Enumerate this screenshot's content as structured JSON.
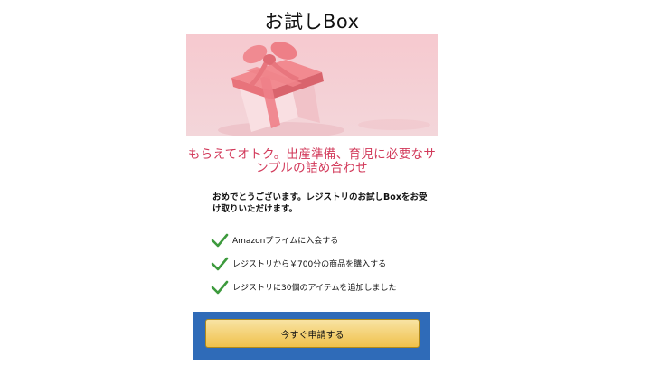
{
  "page": {
    "title": "お試しBox"
  },
  "hero": {
    "image": "pink-gift-box-with-ribbon"
  },
  "tagline": "もらえてオトク。出産準備、育児に必要なサンプルの詰め合わせ",
  "congrats": "おめでとうございます。レジストリのお試しBoxをお受け取りいただけます。",
  "requirements": [
    {
      "icon": "checkmark-icon",
      "label": "Amazonプライムに入会する"
    },
    {
      "icon": "checkmark-icon",
      "label": "レジストリから￥700分の商品を購入する"
    },
    {
      "icon": "checkmark-icon",
      "label": "レジストリに30個のアイテムを追加しました"
    }
  ],
  "cta": {
    "label": "今すぐ申請する"
  },
  "colors": {
    "tagline": "#d2395a",
    "check": "#3d9a3d",
    "cta_highlight": "#2f6bb8",
    "cta_button": "#f0c14b"
  }
}
